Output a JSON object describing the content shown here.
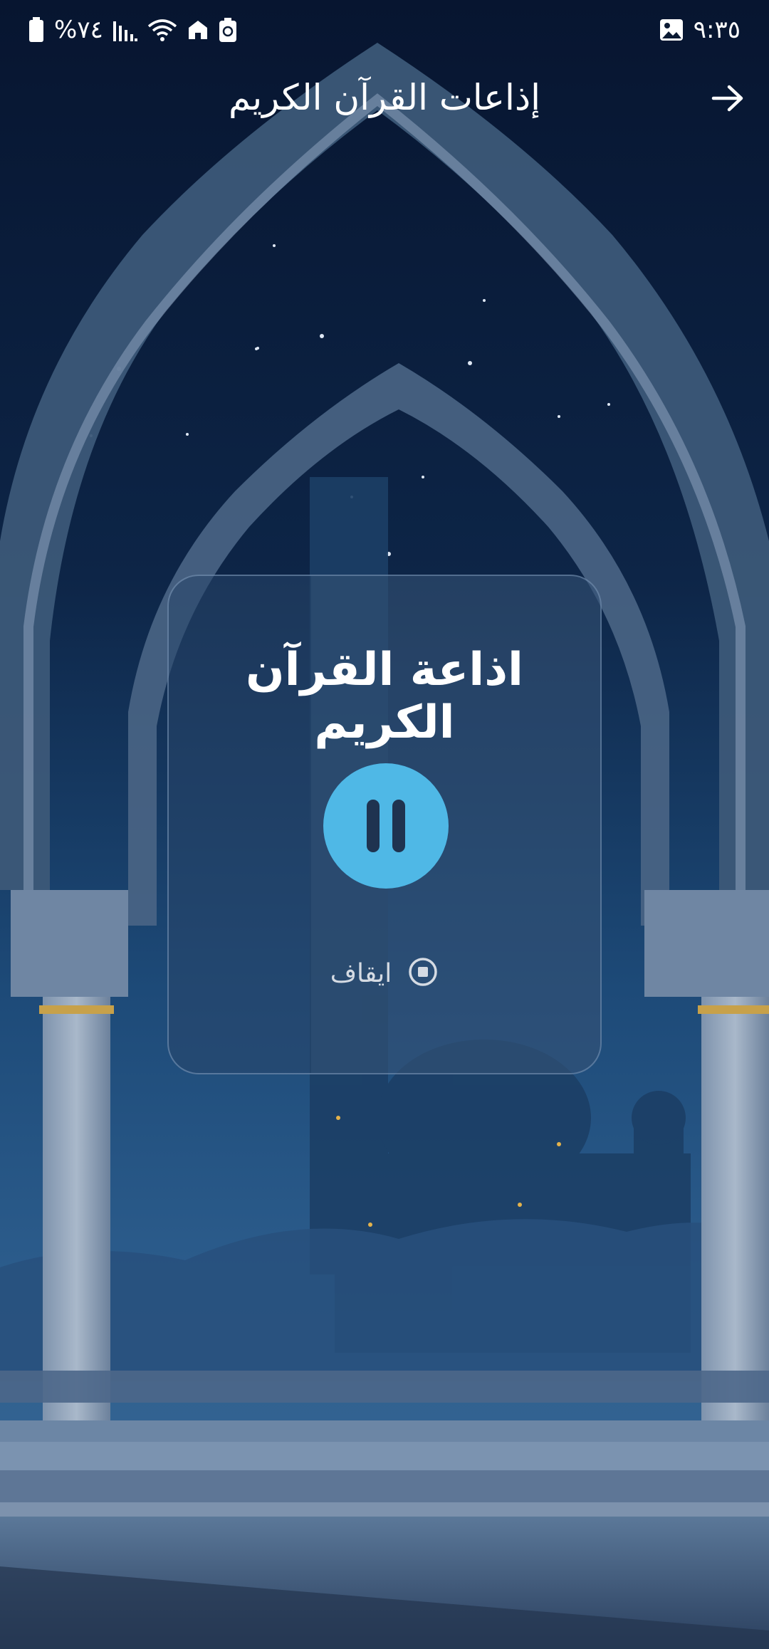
{
  "status_bar": {
    "time": "٩:٣٥",
    "battery": "%٧٤",
    "icons": [
      "battery-icon",
      "signal-icon",
      "wifi-icon",
      "home-icon",
      "recycle-icon",
      "gallery-icon"
    ]
  },
  "header": {
    "title": "إذاعات القرآن الكريم",
    "back_icon": "arrow-right-icon"
  },
  "player": {
    "station_title": "اذاعة القرآن الكريم",
    "state": "playing",
    "pause_icon": "pause-icon",
    "stop_label": "ايقاف",
    "stop_icon": "stop-icon"
  },
  "colors": {
    "accent": "#4fb8e6",
    "background": "#0b1a33",
    "card": "#284669"
  }
}
